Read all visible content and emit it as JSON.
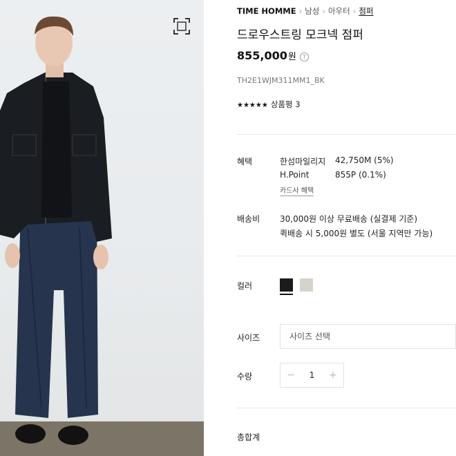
{
  "breadcrumb": {
    "brand": "TIME HOMME",
    "items": [
      "남성",
      "아우터",
      "점퍼"
    ]
  },
  "product": {
    "title": "드로우스트링 모크넥 점퍼",
    "price": "855,000",
    "currency": "원",
    "sku": "TH2E1WJM311MM1_BK",
    "stars": "★★★★★",
    "review_label": "상품평 3"
  },
  "benefit": {
    "label": "혜택",
    "rows": [
      {
        "name": "한섬마일리지",
        "value": "42,750M (5%)"
      },
      {
        "name": "H.Point",
        "value": "855P (0.1%)"
      }
    ],
    "card_link": "카드사 혜택"
  },
  "shipping": {
    "label": "배송비",
    "line1": "30,000원 이상 무료배송 (실결제 기준)",
    "line2": "퀵배송 시 5,000원 별도 (서울 지역만 가능)"
  },
  "color": {
    "label": "컬러",
    "swatches": [
      "#1b1b1b",
      "#d6d3cc"
    ]
  },
  "size": {
    "label": "사이즈",
    "placeholder": "사이즈 선택"
  },
  "quantity": {
    "label": "수량",
    "value": "1",
    "minus": "−",
    "plus": "+"
  },
  "total": {
    "label": "총합계"
  },
  "icons": {
    "zoom": "expand-icon",
    "help": "question-icon"
  }
}
